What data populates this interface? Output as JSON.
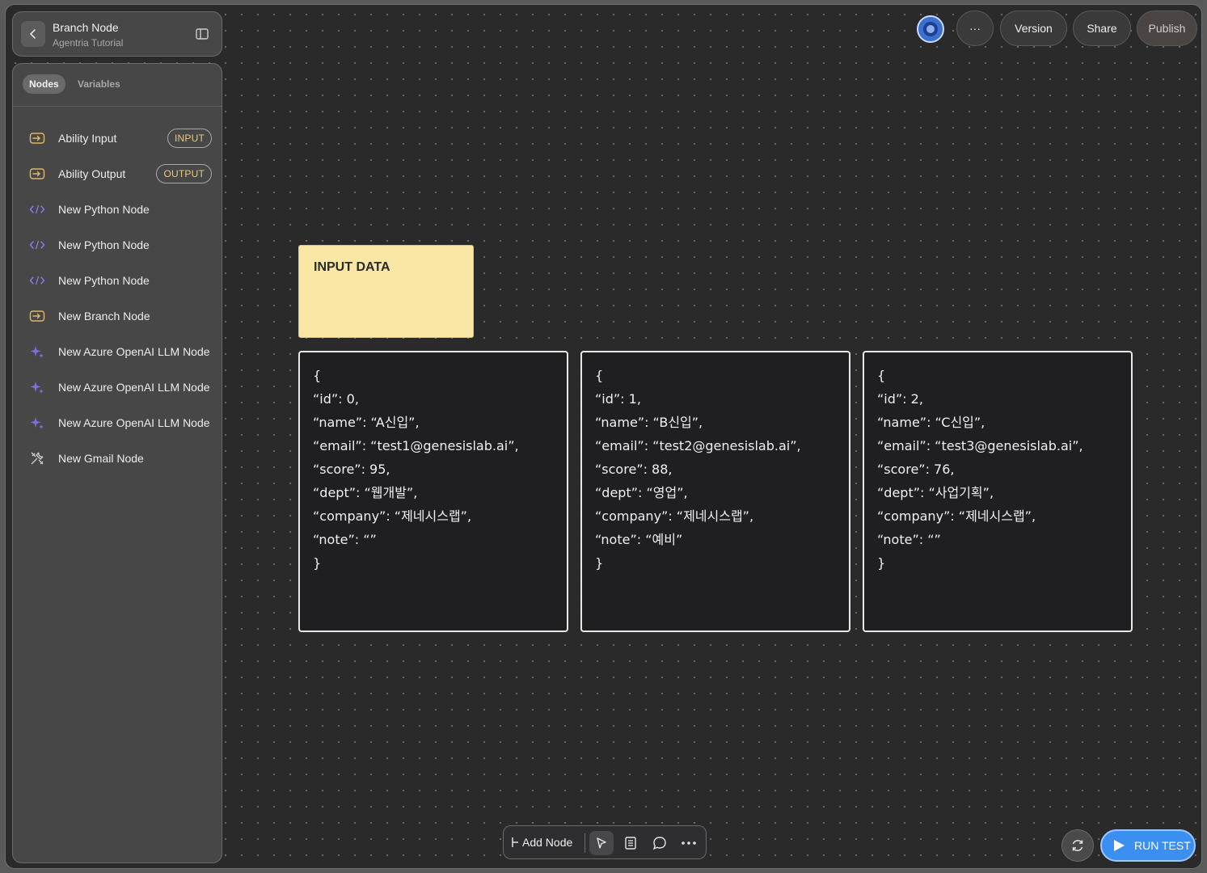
{
  "header": {
    "title": "Branch Node",
    "subtitle": "Agentria Tutorial"
  },
  "sidebar": {
    "tabs": [
      "Nodes",
      "Variables"
    ],
    "items": [
      {
        "label": "Ability Input",
        "icon": "io-icon",
        "badge": "INPUT"
      },
      {
        "label": "Ability Output",
        "icon": "io-icon",
        "badge": "OUTPUT"
      },
      {
        "label": "New Python Node",
        "icon": "code-icon",
        "badge": ""
      },
      {
        "label": "New Python Node",
        "icon": "code-icon",
        "badge": ""
      },
      {
        "label": "New Python Node",
        "icon": "code-icon",
        "badge": ""
      },
      {
        "label": "New Branch Node",
        "icon": "io-icon",
        "badge": ""
      },
      {
        "label": "New Azure OpenAI LLM Node",
        "icon": "sparkle-icon",
        "badge": ""
      },
      {
        "label": "New Azure OpenAI LLM Node",
        "icon": "sparkle-icon",
        "badge": ""
      },
      {
        "label": "New Azure OpenAI LLM Node",
        "icon": "sparkle-icon",
        "badge": ""
      },
      {
        "label": "New Gmail Node",
        "icon": "tools-icon",
        "badge": ""
      }
    ]
  },
  "toolbar": {
    "more_label": "···",
    "version_label": "Version",
    "share_label": "Share",
    "publish_label": "Publish"
  },
  "canvas": {
    "sticky_title": "INPUT DATA",
    "cards": [
      [
        "{",
        "“id”: 0,",
        "“name”: “A신입”,",
        "“email”: “test1@genesislab.ai”,",
        "“score”: 95,",
        "“dept”: “웹개발”,",
        "“company”: “제네시스랩”,",
        "“note”: “”",
        "}"
      ],
      [
        "{",
        "“id”: 1,",
        "“name”: “B신입”,",
        "“email”: “test2@genesislab.ai”,",
        "“score”: 88,",
        "“dept”: “영업”,",
        "“company”: “제네시스랩”,",
        "“note”: “예비”",
        "}"
      ],
      [
        "{",
        "“id”: 2,",
        "“name”: “C신입”,",
        "“email”: “test3@genesislab.ai”,",
        "“score”: 76,",
        "“dept”: “사업기획”,",
        "“company”: “제네시스랩”,",
        "“note”: “”",
        "}"
      ]
    ]
  },
  "bottom_bar": {
    "add_node_label": "Add Node",
    "run_label": "RUN TEST"
  },
  "colors": {
    "accent": "#3b8ff0",
    "badge": "#e7c97c",
    "sticky": "#fbe7a5",
    "icon_purple": "#8b7cf0"
  }
}
